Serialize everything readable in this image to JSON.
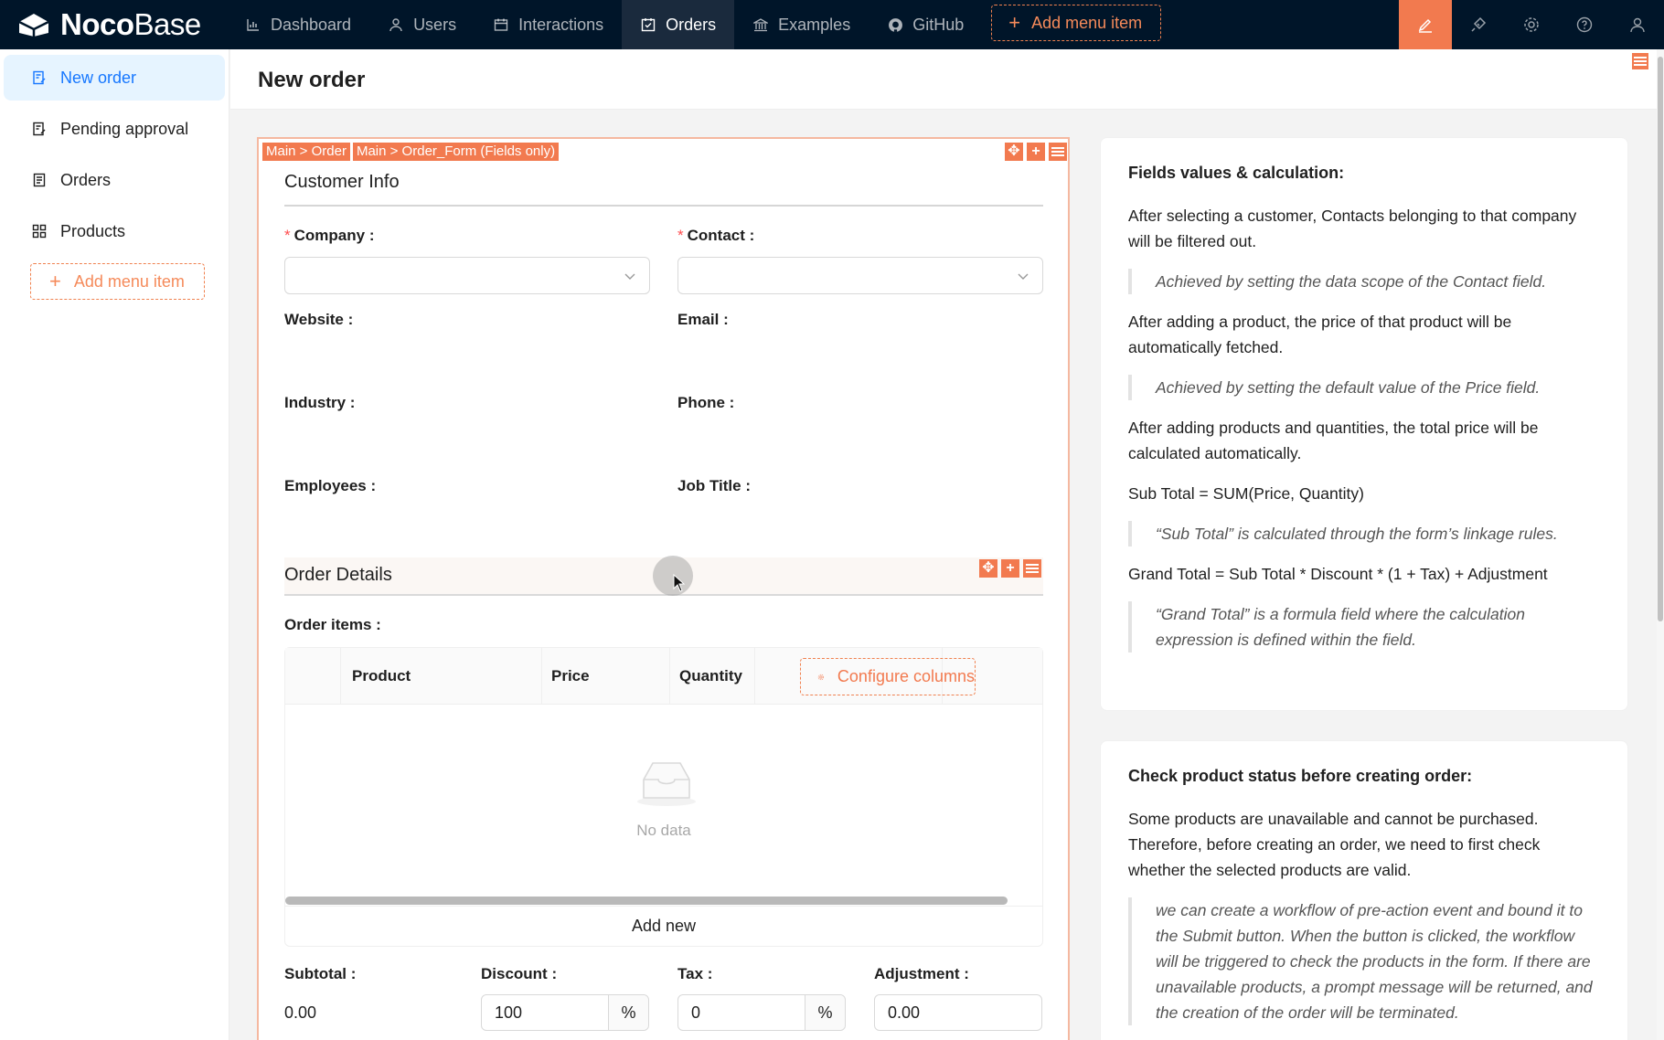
{
  "app": {
    "logo_bold": "Noco",
    "logo_light": "Base"
  },
  "topnav": {
    "items": [
      {
        "label": "Dashboard",
        "icon": "bar-chart-icon"
      },
      {
        "label": "Users",
        "icon": "user-icon"
      },
      {
        "label": "Interactions",
        "icon": "calendar-icon"
      },
      {
        "label": "Orders",
        "icon": "check-square-icon",
        "active": true
      },
      {
        "label": "Examples",
        "icon": "bank-icon"
      },
      {
        "label": "GitHub",
        "icon": "github-icon"
      }
    ],
    "add_menu_item": "Add menu item",
    "right_icons": [
      "ui-editor-icon",
      "plugin-icon",
      "settings-icon",
      "help-icon",
      "user-icon"
    ],
    "accent": "#f27a4f"
  },
  "sidebar": {
    "items": [
      {
        "label": "New order",
        "icon": "form-icon",
        "active": true
      },
      {
        "label": "Pending approval",
        "icon": "form-icon"
      },
      {
        "label": "Orders",
        "icon": "file-text-icon"
      },
      {
        "label": "Products",
        "icon": "appstore-icon"
      }
    ],
    "add_menu_item": "Add menu item"
  },
  "page": {
    "title": "New order"
  },
  "form": {
    "tags": [
      "Main > Order",
      "Main > Order_Form (Fields only)"
    ],
    "customer_section": "Customer Info",
    "fields": {
      "company": "Company",
      "contact": "Contact",
      "website": "Website",
      "email": "Email",
      "industry": "Industry",
      "phone": "Phone",
      "employees": "Employees",
      "job_title": "Job Title"
    },
    "order_section": "Order Details",
    "order_items_label": "Order items",
    "table": {
      "columns": [
        "Product",
        "Price",
        "Quantity"
      ],
      "configure_columns": "Configure columns",
      "empty_text": "No data",
      "add_new": "Add new"
    },
    "summary": {
      "subtotal_label": "Subtotal",
      "subtotal_value": "0.00",
      "discount_label": "Discount",
      "discount_value": "100",
      "discount_unit": "%",
      "tax_label": "Tax",
      "tax_value": "0",
      "tax_unit": "%",
      "adjustment_label": "Adjustment",
      "adjustment_value": "0.00"
    }
  },
  "info_cards": [
    {
      "title": "Fields values & calculation:",
      "blocks": [
        {
          "type": "p",
          "text": "After selecting a customer, Contacts belonging to that company will be filtered out."
        },
        {
          "type": "quote",
          "text": "Achieved by setting the data scope of the Contact field."
        },
        {
          "type": "p",
          "text": "After adding a product, the price of that product will be automatically fetched."
        },
        {
          "type": "quote",
          "text": "Achieved by setting the default value of the Price field."
        },
        {
          "type": "p",
          "text": "After adding products and quantities, the total price will be calculated automatically."
        },
        {
          "type": "p",
          "text": "Sub Total = SUM(Price, Quantity)"
        },
        {
          "type": "quote",
          "text": "“Sub Total” is calculated through the form’s linkage rules."
        },
        {
          "type": "p",
          "text": "Grand Total = Sub Total * Discount * (1 + Tax) + Adjustment"
        },
        {
          "type": "quote",
          "text": "“Grand Total” is a formula field where the calculation expression is defined within the field."
        }
      ]
    },
    {
      "title": "Check product status before creating order:",
      "blocks": [
        {
          "type": "p",
          "text": "Some products are unavailable and cannot be purchased. Therefore, before creating an order, we need to first check whether the selected products are valid."
        },
        {
          "type": "quote",
          "text": "we can create a workflow of pre-action event and bound it to the Submit button. When the button is clicked, the workflow will be triggered to check the products in the form. If there are unavailable products, a prompt message will be returned, and the creation of the order will be terminated."
        }
      ]
    }
  ]
}
